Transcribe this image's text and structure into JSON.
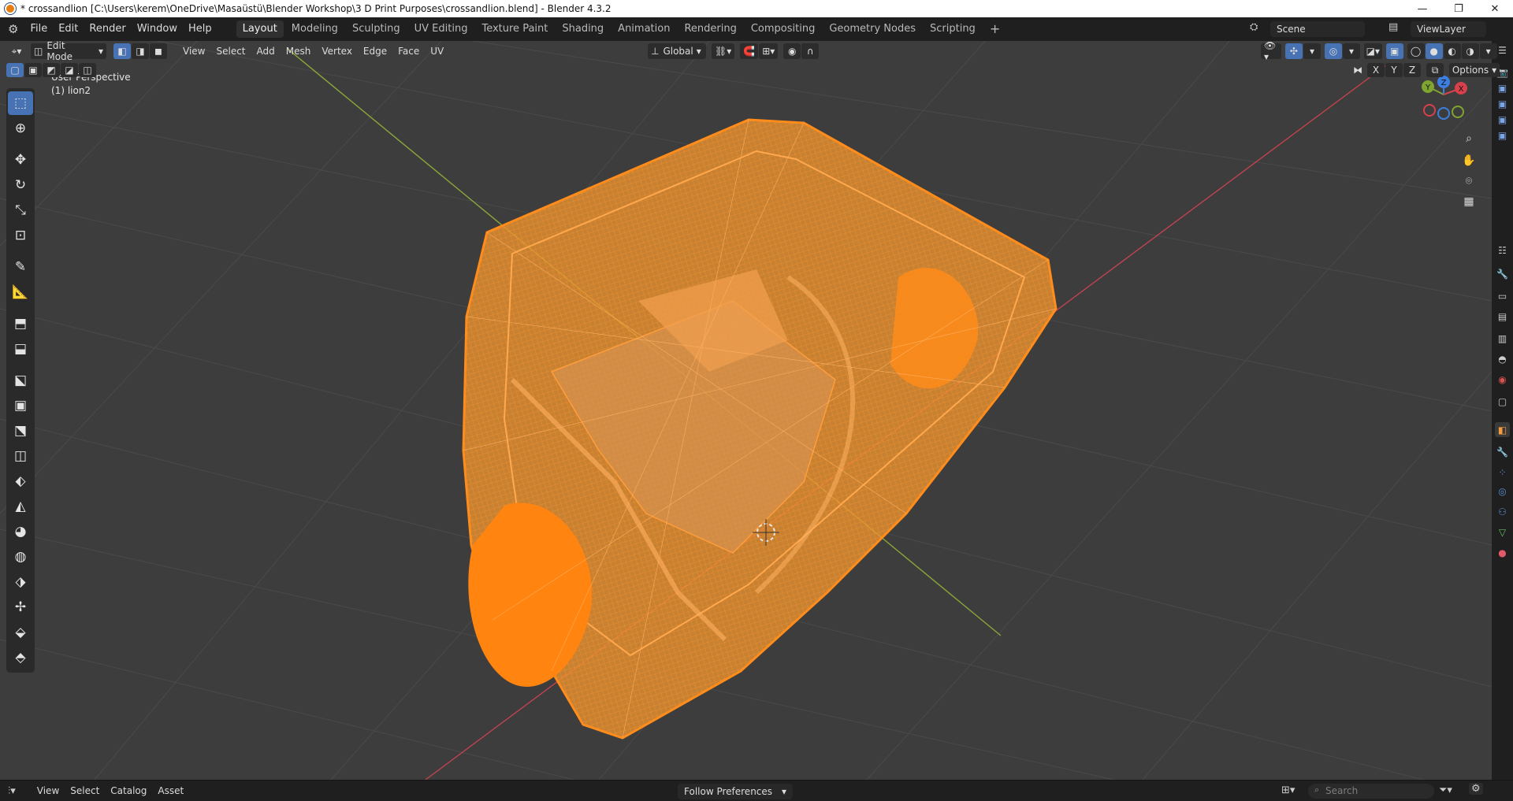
{
  "window": {
    "title": "* crossandlion [C:\\Users\\kerem\\OneDrive\\Masaüstü\\Blender Workshop\\3 D Print Purposes\\crossandlion.blend] - Blender 4.3.2",
    "minimize": "—",
    "restore": "❐",
    "close": "✕"
  },
  "menubar": {
    "items": [
      "File",
      "Edit",
      "Render",
      "Window",
      "Help"
    ]
  },
  "workspaces": {
    "tabs": [
      "Layout",
      "Modeling",
      "Sculpting",
      "UV Editing",
      "Texture Paint",
      "Shading",
      "Animation",
      "Rendering",
      "Compositing",
      "Geometry Nodes",
      "Scripting"
    ],
    "add": "+",
    "active_index": 0
  },
  "scene": {
    "label": "Scene",
    "view_layer": "ViewLayer"
  },
  "viewport_header": {
    "mode": "Edit Mode",
    "menus": [
      "View",
      "Select",
      "Add",
      "Mesh",
      "Vertex",
      "Edge",
      "Face",
      "UV"
    ],
    "transform_orientation": "Global",
    "axis_x": "X",
    "axis_y": "Y",
    "axis_z": "Z",
    "options": "Options"
  },
  "overlay_text": {
    "view": "User Perspective",
    "object": "(1) lion2"
  },
  "gizmo": {
    "x": "X",
    "y": "Y",
    "z": "Z"
  },
  "colors": {
    "accent": "#4772b3",
    "mesh": "#ff8c1a",
    "x_axis": "#d6414b",
    "y_axis": "#7fa530",
    "z_axis": "#3c7fe0",
    "viewport_bg": "#3d3d3d"
  },
  "icons": {
    "toolbar": [
      "select-box-icon",
      "cursor-icon",
      "move-icon",
      "rotate-icon",
      "scale-icon",
      "transform-icon",
      "annotate-icon",
      "measure-icon",
      "add-cube-icon",
      "extrude-region-icon",
      "inset-faces-icon",
      "bevel-icon",
      "loop-cut-icon",
      "knife-icon",
      "poly-build-icon",
      "spin-icon",
      "smooth-icon",
      "edge-slide-icon",
      "shrink-fatten-icon",
      "shear-icon",
      "rip-region-icon"
    ],
    "properties": [
      "tool-icon",
      "render-icon",
      "output-icon",
      "view-layer-icon",
      "scene-icon",
      "world-icon",
      "collection-icon",
      "object-icon",
      "modifier-icon",
      "particles-icon",
      "physics-icon",
      "constraints-icon",
      "data-icon",
      "material-icon"
    ]
  },
  "bottombar": {
    "menus": [
      "View",
      "Select",
      "Catalog",
      "Asset"
    ],
    "import_method": "Follow Preferences",
    "search_placeholder": "Search"
  }
}
